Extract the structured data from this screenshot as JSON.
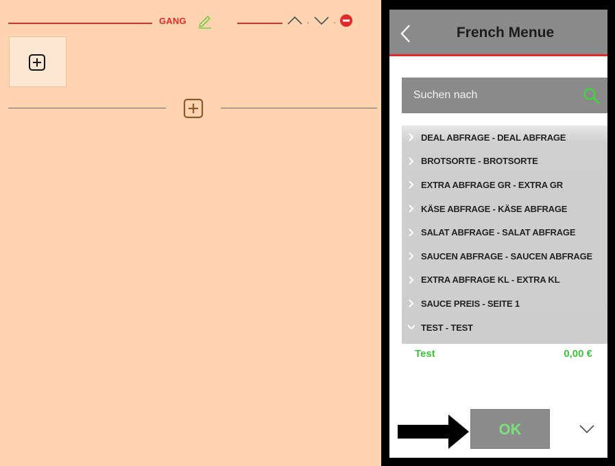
{
  "gang": {
    "label": "GANG"
  },
  "nav": {
    "separator": "·"
  },
  "menu": {
    "title": "French Menue",
    "search_placeholder": "Suchen nach",
    "groups": [
      {
        "label": "DEAL ABFRAGE - DEAL ABFRAGE",
        "expanded": false
      },
      {
        "label": "BROTSORTE - BROTSORTE",
        "expanded": false
      },
      {
        "label": "EXTRA ABFRAGE GR - EXTRA GR",
        "expanded": false
      },
      {
        "label": "KÄSE ABFRAGE - KÄSE ABFRAGE",
        "expanded": false
      },
      {
        "label": "SALAT ABFRAGE - SALAT ABFRAGE",
        "expanded": false
      },
      {
        "label": "SAUCEN ABFRAGE - SAUCEN ABFRAGE",
        "expanded": false
      },
      {
        "label": "EXTRA ABFRAGE KL - EXTRA KL",
        "expanded": false
      },
      {
        "label": "SAUCE PREIS - SEITE 1",
        "expanded": false
      },
      {
        "label": "TEST - TEST",
        "expanded": true
      }
    ],
    "selected_item": {
      "name": "Test",
      "price": "0,00 €"
    },
    "ok_label": "OK"
  },
  "colors": {
    "panel_bg": "#fed5b0",
    "accent_red": "#e02b2b",
    "accent_green": "#3ec33e",
    "header_gray": "#8a8a8a"
  }
}
